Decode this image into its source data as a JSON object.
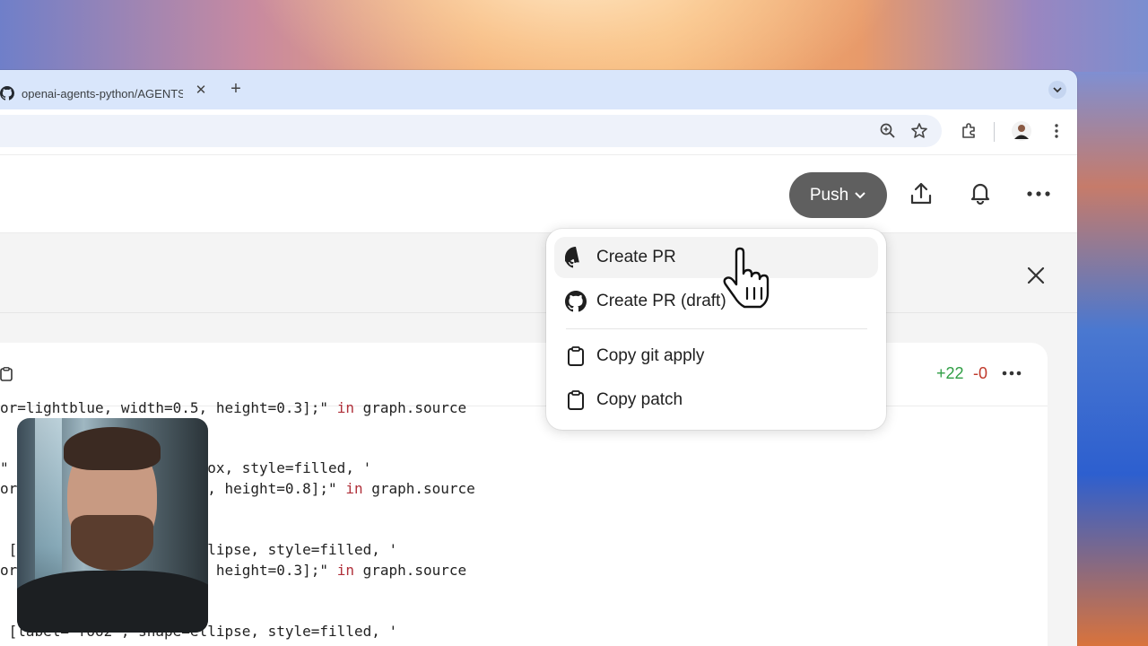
{
  "browser": {
    "tab_title": "openai-agents-python/AGENTS.md",
    "tab_close": "✕",
    "new_tab": "+"
  },
  "header": {
    "push_label": "Push"
  },
  "menu": {
    "items": [
      {
        "label": "Create PR",
        "icon": "github-icon"
      },
      {
        "label": "Create PR (draft)",
        "icon": "github-icon"
      },
      {
        "label": "Copy git apply",
        "icon": "clipboard-icon"
      },
      {
        "label": "Copy patch",
        "icon": "clipboard-icon"
      }
    ]
  },
  "diff": {
    "added": "+22",
    "removed": "-0"
  },
  "code": {
    "lines": [
      {
        "text": "or=lightblue, width=0.5, height=0.3];\" ",
        "kw": "in",
        "rest": " graph.source"
      },
      {
        "text": "\"                    e=box, style=filled, '",
        "kw": "",
        "rest": ""
      },
      {
        "text": "or                    .5, height=0.8];\" ",
        "kw": "in",
        "rest": " graph.source"
      },
      {
        "text": " [                    ellipse, style=filled, '",
        "kw": "",
        "rest": ""
      },
      {
        "text": "or                    5, height=0.3];\" ",
        "kw": "in",
        "rest": " graph.source"
      },
      {
        "text": " [label=\"foo2\", shape=ellipse, style=filled, '",
        "kw": "",
        "rest": ""
      }
    ]
  },
  "colors": {
    "tabbar": "#d9e6fb",
    "push_bg": "#5f5f5f",
    "added": "#2f9e44",
    "removed": "#c0392b",
    "keyword": "#b0303a"
  }
}
